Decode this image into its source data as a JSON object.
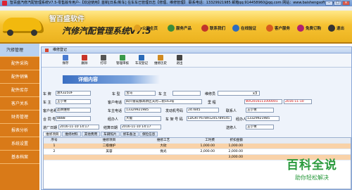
{
  "window": {
    "title": "智百盛汽修汽配管理系统V7.5-零售版专用户-【欢迎使用】首新[日系/新车] 在车车已管理日志【修理、维修管理】 联系电话：13329921985 邮箱qq:914458960@qq.com 网站：www.baishengsoft.com"
  },
  "header": {
    "brand": "智百盛软件",
    "product": "汽修汽配管理系统V7.5",
    "buttons": [
      {
        "label": "公司主页",
        "color": "#e0a020"
      },
      {
        "label": "服务产品",
        "color": "#3a8c3a"
      },
      {
        "label": "联系我们",
        "color": "#c0342b"
      },
      {
        "label": "在线验证",
        "color": "#2d6cc0"
      },
      {
        "label": "客户服务",
        "color": "#d65a1f"
      },
      {
        "label": "免费订购",
        "color": "#b02070"
      },
      {
        "label": "退出",
        "color": "#333333"
      }
    ]
  },
  "sidebar": {
    "items": [
      "汽修管理",
      "配件采购",
      "配件销售",
      "配件库存",
      "客户关系",
      "财务管理",
      "报表分析",
      "系统设置",
      "基本档案"
    ]
  },
  "frame": {
    "title": "维修登记",
    "banner": "详细内容",
    "toolbar": [
      {
        "label": "保存",
        "color": "#4a7bd0"
      },
      {
        "label": "删除",
        "color": "#c8342a"
      },
      {
        "label": "打印",
        "color": "#555555"
      },
      {
        "label": "管理审核",
        "color": "#3a9a4a"
      },
      {
        "label": "车况登记",
        "color": "#2a6ab8"
      },
      {
        "label": "维修历史",
        "color": "#d08a20"
      },
      {
        "label": "退出",
        "color": "#444444"
      }
    ]
  },
  "form": {
    "labels": {
      "plate": "车 牌",
      "vehicle_type": "车 型",
      "owner": "车 主",
      "phone": "客户电话",
      "customer": "客户名称",
      "contact_phone": "车主电话",
      "engine": "发动机号码",
      "warranty": "合 同 号",
      "mileage": "里 程",
      "vin": "车 架 号 码",
      "entry_time": "进厂日期",
      "settle_time": "结算日期",
      "vehicle": "车 辆",
      "driver": "驾 驶 员",
      "repairer": "维修员",
      "contact_person": "联系人",
      "factory_date": "出厂日期",
      "model": "型号",
      "operator": "经办人",
      "remark": "送修人"
    },
    "values": {
      "plate": "浙X325UF",
      "vehicle_type": "宝马",
      "owner": "王小青",
      "phone": "四川省成都高新区天府二街163号",
      "customer": "品牌维修",
      "contact_phone": "13329921985",
      "engine": "247845",
      "warranty": "8888",
      "mileage": "大能",
      "vin": "LDGRTY67891245789545",
      "entry_time": "2016-11-10 14:17",
      "settle_time": "2016-11-10 14:17",
      "order_no": "WX2016111000001",
      "factory_date": "2016-11-10",
      "contact_person": "王小青",
      "contact_phone2": "13329921985",
      "operator_phone": "13329921985",
      "sent_by": "王小青",
      "engine_type": "x3"
    }
  },
  "tabs": [
    "维修项目",
    "维修材料",
    "其他费用",
    "车辆照片",
    "修车备注",
    "保险信息"
  ],
  "grid": {
    "headers": [
      "序号",
      "维修项目",
      "维修工艺",
      "工时费",
      "折扣金额"
    ],
    "rows": [
      [
        "1",
        "二级维护",
        "大砍",
        "1,000.00",
        "1,000.00"
      ],
      [
        "2",
        "美容",
        "抛光",
        "2,000.00",
        "2,000.00"
      ]
    ],
    "total": "3,000.00"
  },
  "watermark": {
    "line1": "百科全说",
    "line2": "助你轻松解决"
  }
}
